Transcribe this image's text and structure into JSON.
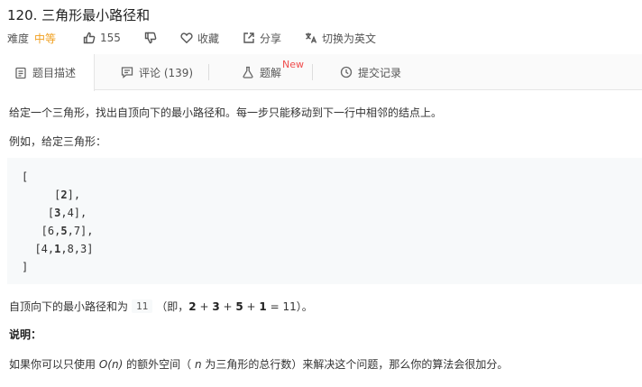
{
  "problem": {
    "title": "120. 三角形最小路径和"
  },
  "meta": {
    "difficulty_label": "难度",
    "difficulty_value": "中等",
    "likes": "155",
    "favorite_label": "收藏",
    "share_label": "分享",
    "switch_lang_label": "切换为英文"
  },
  "tabs": {
    "description": "题目描述",
    "comments": "评论 (139)",
    "solutions": "题解",
    "solutions_badge": "New",
    "submissions": "提交记录"
  },
  "content": {
    "intro": "给定一个三角形，找出自顶向下的最小路径和。每一步只能移动到下一行中相邻的结点上。",
    "example_intro": "例如，给定三角形：",
    "code_lines": [
      "[",
      "     [2],",
      "    [3,4],",
      "   [6,5,7],",
      "  [4,1,8,3]",
      "]"
    ],
    "result_prefix": "自顶向下的最小路径和为",
    "result_value": "11",
    "result_open": "（即，",
    "result_terms": [
      "2",
      "3",
      "5",
      "1"
    ],
    "result_equals": "= 11",
    "result_close": "）。",
    "note_heading": "说明：",
    "note_pre": "如果你可以只使用",
    "note_complexity": "O(n)",
    "note_mid1": "的额外空间（",
    "note_n": "n",
    "note_rest": "为三角形的总行数）来解决这个问题，那么你的算法会很加分。"
  },
  "colors": {
    "difficulty_medium": "#f0a020",
    "new_badge": "#f04c4c",
    "code_background": "#f7f9fa"
  }
}
